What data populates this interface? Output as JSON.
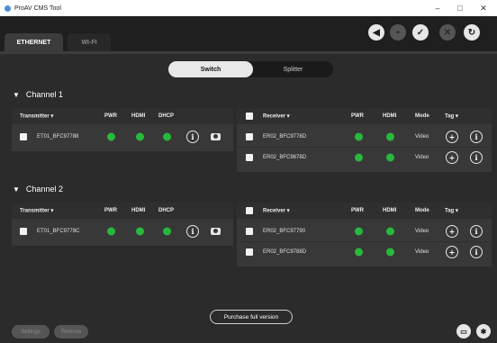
{
  "window": {
    "title": "ProAV CMS Tool",
    "controls": {
      "minimize": "–",
      "maximize": "□",
      "close": "✕"
    }
  },
  "header": {
    "tabs": [
      {
        "label": "ETHERNET",
        "active": true
      },
      {
        "label": "WI-FI",
        "active": false
      }
    ],
    "toolbar_icons": [
      {
        "name": "megaphone-icon",
        "glyph": "◀",
        "enabled": true
      },
      {
        "name": "trash-icon",
        "glyph": "▪",
        "enabled": false
      },
      {
        "name": "check-icon",
        "glyph": "✓",
        "enabled": true
      },
      {
        "name": "close-icon",
        "glyph": "✕",
        "enabled": false
      },
      {
        "name": "refresh-icon",
        "glyph": "↻",
        "enabled": true
      }
    ]
  },
  "mode_toggle": {
    "options": [
      "Switch",
      "Splitter"
    ],
    "selected": "Switch"
  },
  "status_colors": {
    "on": "#28b83c"
  },
  "channels": [
    {
      "title": "Channel 1",
      "transmitter": {
        "headers": {
          "name": "Transmitter ▾",
          "pwr": "PWR",
          "hdmi": "HDMI",
          "dhcp": "DHCP"
        },
        "rows": [
          {
            "name": "ET01_BFC97788"
          }
        ]
      },
      "receiver": {
        "headers": {
          "name": "Receiver ▾",
          "pwr": "PWR",
          "hdmi": "HDMI",
          "mode": "Mode",
          "tag": "Tag ▾"
        },
        "rows": [
          {
            "name": "ER02_BFC9778D",
            "mode": "Video"
          },
          {
            "name": "ER02_BFC9878D",
            "mode": "Video"
          }
        ]
      }
    },
    {
      "title": "Channel 2",
      "transmitter": {
        "headers": {
          "name": "Transmitter ▾",
          "pwr": "PWR",
          "hdmi": "HDMI",
          "dhcp": "DHCP"
        },
        "rows": [
          {
            "name": "ET01_BFC9778C"
          }
        ]
      },
      "receiver": {
        "headers": {
          "name": "Receiver ▾",
          "pwr": "PWR",
          "hdmi": "HDMI",
          "mode": "Mode",
          "tag": "Tag ▾"
        },
        "rows": [
          {
            "name": "ER02_BFC97790",
            "mode": "Video"
          },
          {
            "name": "ER02_BFC9788D",
            "mode": "Video"
          }
        ]
      }
    }
  ],
  "footer": {
    "purchase_label": "Purchase full version",
    "settings_label": "Settings",
    "remove_label": "Remove"
  }
}
